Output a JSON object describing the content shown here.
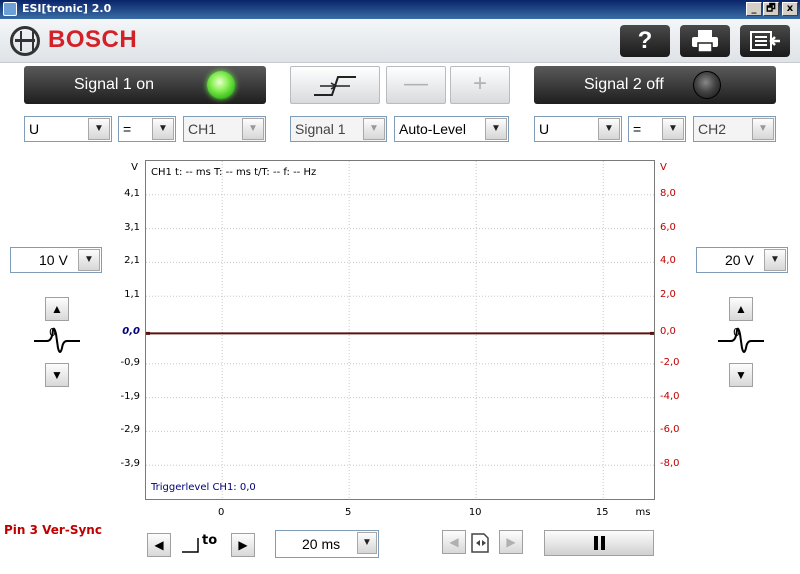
{
  "window": {
    "title": "ESI[tronic] 2.0",
    "controls": [
      "_",
      "🗗",
      "x"
    ]
  },
  "header": {
    "brand": "BOSCH",
    "help_label": "?",
    "print_icon": "printer-icon",
    "menu_icon": "menu-back-icon"
  },
  "signal1": {
    "label": "Signal 1 on",
    "led": "on"
  },
  "signal2": {
    "label": "Signal 2 off",
    "led": "off"
  },
  "center_buttons": {
    "trigger_icon": "trigger-edge-icon",
    "minus_label": "—",
    "plus_label": "+"
  },
  "channel1": {
    "quantity": "U",
    "coupling": "=",
    "channel": "CH1"
  },
  "trigger": {
    "source": "Signal 1",
    "mode": "Auto-Level"
  },
  "channel2": {
    "quantity": "U",
    "coupling": "=",
    "channel": "CH2"
  },
  "left_axis": {
    "unit": "V",
    "ticks": [
      "4,1",
      "3,1",
      "2,1",
      "1,1",
      "0,0",
      "-0,9",
      "-1,9",
      "-2,9",
      "-3,9"
    ],
    "range_label": "10 V"
  },
  "right_axis": {
    "unit": "V",
    "ticks": [
      "8,0",
      "6,0",
      "4,0",
      "2,0",
      "0,0",
      "-2,0",
      "-4,0",
      "-6,0",
      "-8,0"
    ],
    "range_label": "20 V"
  },
  "x_axis": {
    "ticks": [
      "0",
      "5",
      "10",
      "15"
    ],
    "unit": "ms"
  },
  "chart_info": {
    "measurement": "CH1  t: -- ms   T: -- ms   t/T: --   f: -- Hz",
    "triggerlevel": "Triggerlevel CH1: 0,0"
  },
  "chart_data": {
    "type": "line",
    "x": [
      0,
      17
    ],
    "series": [
      {
        "values": [
          0,
          0
        ]
      }
    ],
    "xlabel": "ms",
    "ylabel": "V",
    "xlim": [
      -3,
      17
    ],
    "ylim": [
      -4.9,
      5.1
    ],
    "grid": true,
    "y2label": "V",
    "y2lim": [
      -10,
      10
    ],
    "legend": "none"
  },
  "bottom": {
    "pin_label": "Pin 3 Ver-Sync",
    "timebase": "20 ms",
    "trigger_pos_label": "to"
  },
  "colors": {
    "accent_red": "#c00000",
    "brand_red": "#d42027",
    "led_green": "#3cc21e",
    "trace": "#5a1010"
  }
}
